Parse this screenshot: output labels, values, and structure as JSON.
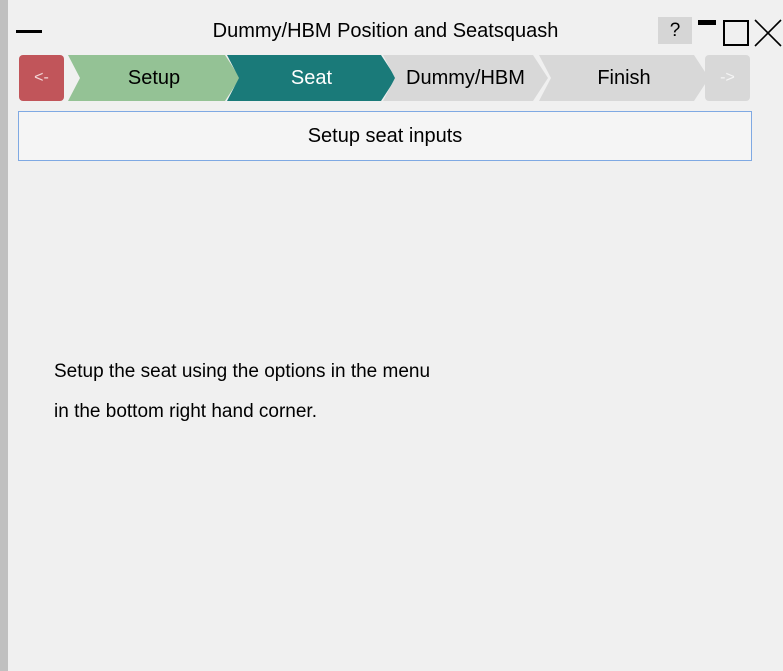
{
  "window": {
    "title": "Dummy/HBM Position and Seatsquash",
    "help_label": "?"
  },
  "wizard": {
    "back_label": "<-",
    "forward_label": "->",
    "steps": [
      {
        "label": "Setup",
        "state": "completed",
        "color": "#94c295"
      },
      {
        "label": "Seat",
        "state": "active",
        "color": "#1a7a79"
      },
      {
        "label": "Dummy/HBM",
        "state": "pending",
        "color": "#d8d8d8"
      },
      {
        "label": "Finish",
        "state": "pending",
        "color": "#d8d8d8"
      }
    ]
  },
  "section": {
    "title": "Setup seat inputs"
  },
  "message": {
    "line1": "Setup the seat using the options in the menu",
    "line2": "in the bottom right hand corner."
  }
}
